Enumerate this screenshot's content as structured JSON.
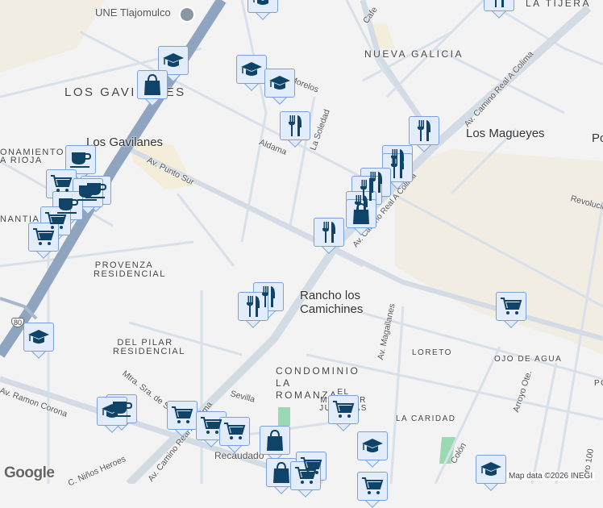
{
  "places": {
    "une": "UNE Tlajomulco",
    "los_gavilanes_hood": "LOS GAVILANES",
    "los_gavilanes_town": "Los Gavilanes",
    "fraccionamiento": "ONAMIENTO",
    "la_rioja": "A RIOJA",
    "manantial": "NANTIAL",
    "provenza": "PROVENZA RESIDENCIAL",
    "del_pilar": "DEL PILAR RESIDENCIAL",
    "nueva_galicia": "NUEVA GALICIA",
    "la_tijera": "LA TIJERA",
    "los_magueyes": "Los Magueyes",
    "po": "Po",
    "rancho": "Rancho los Camichines",
    "condominio": "CONDOMINIO LA ROMANZA",
    "el_mirador": "EL MIRADOR JUAN LAS",
    "loreto": "LORETO",
    "ojo_de_agua": "OJO DE AGUA",
    "la_caridad": "LA CARIDAD",
    "recaudadora": "Recaudado",
    "po2": "PO"
  },
  "streets": {
    "punto_sur": "Av. Punto Sur",
    "aldama": "Aldama",
    "la_soledad": "La Soledad",
    "morelos": "Morelos",
    "camino_real_ne": "Av. Camino Real A Colima",
    "camino_real_mid": "Av. Camino Real A Colima",
    "camino_real_sw": "Av. Camino Real A Colima",
    "sevilla": "Sevilla",
    "ramon_corona": "Av. Ramon Corona",
    "ninos_heroes": "C. Niños Heroes",
    "mtra": "Mtra. Sra. de Sta",
    "magallanes": "Av. Magallanes",
    "arroyo": "Arroyo Ote.",
    "colon": "Colón",
    "revolucion": "Revolucion",
    "cafe": "Cafe",
    "retorno": "ro 100",
    "hwy": "80"
  },
  "footer": {
    "attribution": "Map data ©2026 INEGI",
    "logo": "Google"
  },
  "colors": {
    "highway": "#8fa5bf",
    "arterial": "#d3dbe4",
    "street": "#d8e0ea",
    "land": "#f4f3f4",
    "beige": "#f1ede3",
    "marker_bg": "#e3ecfb",
    "marker_icon": "#0f4468"
  }
}
